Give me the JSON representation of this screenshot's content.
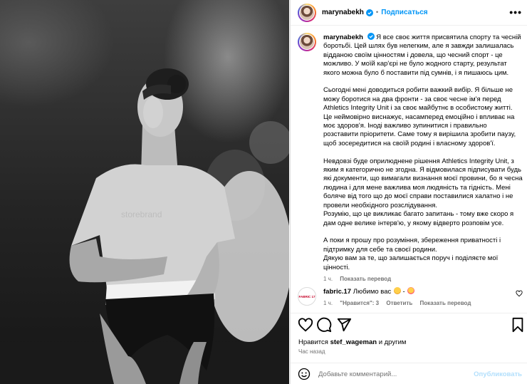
{
  "post": {
    "username": "marynabekh",
    "follow_label": "Подписаться",
    "separator": "•",
    "more_label": "•••"
  },
  "caption": {
    "username": "marynabekh",
    "p1": "Я все своє життя присвятила спорту та чесній боротьбі. Цей шлях був нелегким, але я завжди залишалась відданою своїм цінностям і довела, що чесний спорт - це можливо. У моїй кар'єрі не було жодного старту, результат якого можна було б поставити під сумнів, і я пишаюсь цим.",
    "p2": "Сьогодні мені доводиться робити важкий вибір. Я більше не можу боротися на два фронти - за своє чесне ім'я перед Athletics Integrity Unit і за своє майбутнє в особистому житті. Це неймовірно виснажує, насамперед емоційно і впливає на моє здоров'я. Іноді важливо зупинитися і правильно розставити пріоритети. Саме тому я вирішила зробити паузу, щоб зосередитися на своїй родині і власному здоров'ї.",
    "p3": "Невдовзі буде оприлюднене рішення Athletics Integrity Unit, з яким я категорично не згодна. Я відмовилася підписувати будь які документи, що вимагали визнання моєї провини, бо я чесна людина і для мене важлива моя людяність та гідність. Мені боляче від того що до моєї справи поставилися халатно і не провели необхідного розслідування.\nРозумію, що це викликає багато запитань - тому вже скоро я дам одне велике інтерв'ю, у якому відверто розповім усе.",
    "p4": "А поки я прошу про розуміння, збереження приватності і підтримку для себе та своєї родини.\nДякую вам за те, що залишається поруч і поділяєте мої цінності.",
    "time": "1 ч.",
    "translate": "Показать перевод"
  },
  "comment": {
    "avatar_text": "FABRIC 17",
    "username": "fabric.17",
    "text": "Любимо вас",
    "time": "1 ч.",
    "likes": "\"Нравится\": 3",
    "reply": "Ответить",
    "translate": "Показать перевод"
  },
  "footer": {
    "likes_prefix": "Нравится",
    "likes_user": "stef_wageman",
    "likes_suffix": "и другим",
    "time": "Час назад",
    "comment_placeholder": "Добавьте комментарий...",
    "publish_label": "Опубликовать"
  },
  "colors": {
    "accent": "#0095f6",
    "muted": "#737373",
    "publish_disabled": "#b2dffc"
  },
  "icons": [
    "heart-icon",
    "comment-icon",
    "share-icon",
    "bookmark-icon",
    "emoji-icon",
    "verified-icon",
    "more-icon"
  ]
}
